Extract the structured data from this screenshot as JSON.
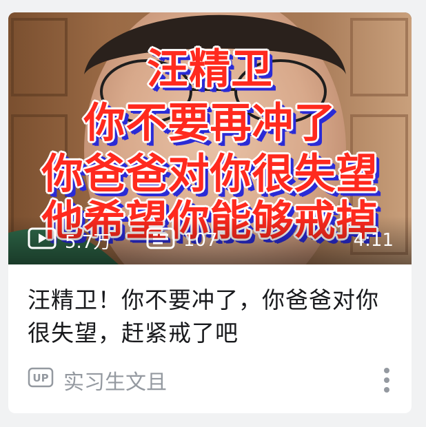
{
  "video_card": {
    "cover_text_lines": [
      "汪精卫",
      "你不要再冲了",
      "你爸爸对你很失望",
      "他希望你能够戒掉"
    ],
    "play_count": "5.7万",
    "danmaku_count": "107",
    "duration": "4:11",
    "title": "汪精卫！你不要冲了，你爸爸对你很失望，赶紧戒了吧",
    "up_badge": "UP",
    "uploader": "实习生文且"
  },
  "icons": {
    "play": "play-count-icon",
    "danmaku": "danmaku-icon",
    "up": "up-badge-icon",
    "more": "more-vertical-icon"
  },
  "colors": {
    "page_bg": "#f1f2f3",
    "title": "#18191c",
    "meta": "#9499a0",
    "cover_text": "#ff2a1e",
    "cover_text_shadow": "#2a2bd6"
  }
}
